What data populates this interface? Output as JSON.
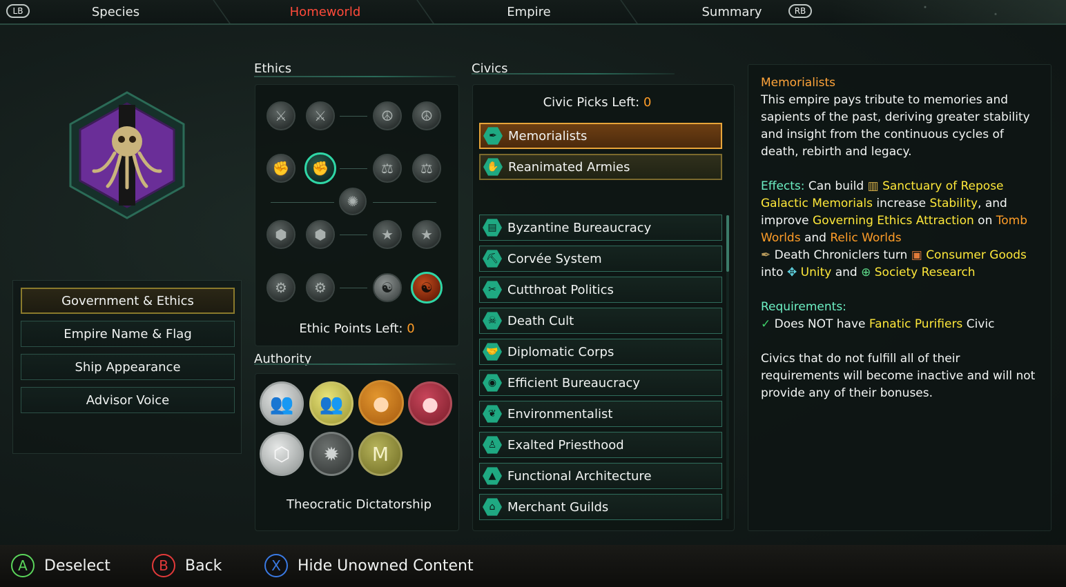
{
  "tabs": {
    "lb": "LB",
    "rb": "RB",
    "items": [
      "Species",
      "Homeworld",
      "Empire",
      "Summary"
    ],
    "active_index": 1
  },
  "left_menu": [
    "Government & Ethics",
    "Empire Name & Flag",
    "Ship Appearance",
    "Advisor Voice"
  ],
  "ethics": {
    "title": "Ethics",
    "points_label": "Ethic Points Left: ",
    "points_value": "0"
  },
  "authority": {
    "title": "Authority",
    "selected_name": "Theocratic Dictatorship"
  },
  "civics": {
    "title": "Civics",
    "picks_label": "Civic Picks Left: ",
    "picks_value": "0",
    "selected": [
      "Memorialists",
      "Reanimated Armies"
    ],
    "list": [
      "Byzantine Bureaucracy",
      "Corvée System",
      "Cutthroat Politics",
      "Death Cult",
      "Diplomatic Corps",
      "Efficient Bureaucracy",
      "Environmentalist",
      "Exalted Priesthood",
      "Functional Architecture",
      "Merchant Guilds"
    ]
  },
  "description": {
    "title": "Memorialists",
    "body": "This empire pays tribute to memories and sapients of the past, deriving greater stability and insight from the continuous cycles of death, rebirth and legacy.",
    "effects_label": "Effects:",
    "effects_t1": " Can build ",
    "sanctuary": "Sanctuary of Repose",
    "galactic": "Galactic Memorials",
    "t2": " increase ",
    "stability": "Stability",
    "t3": ", and improve ",
    "governing": "Governing Ethics Attraction",
    "t4": " on ",
    "tomb": "Tomb Worlds",
    "t5": " and ",
    "relic": "Relic Worlds",
    "t6": " Death Chroniclers turn ",
    "consumer": "Consumer Goods",
    "t7": " into ",
    "unity": "Unity",
    "t8": " and ",
    "society": "Society Research",
    "req_label": "Requirements:",
    "req_t1": " Does NOT have ",
    "req_purifiers": "Fanatic Purifiers",
    "req_t2": " Civic",
    "footer": "Civics that do not fulfill all of their requirements will become inactive and will not provide any of their bonuses."
  },
  "bottom": {
    "a_key": "A",
    "a_label": "Deselect",
    "b_key": "B",
    "b_label": "Back",
    "x_key": "X",
    "x_label": "Hide Unowned Content"
  },
  "colors": {
    "accent_teal": "#2fd6a6",
    "active_tab": "#ff4a3a",
    "highlight_orange": "#ff9d28",
    "highlight_yellow": "#ffe83a",
    "emblem_purple": "#6a2e98"
  },
  "icons": {
    "ethics": [
      "crossed-swords-icon",
      "peace-icon",
      "fist-icon",
      "scales-icon",
      "gestalt-icon",
      "collective-icon",
      "star-icon",
      "cog-icon",
      "meditation-icon"
    ],
    "authority": [
      "democratic-icon",
      "oligarchic-icon",
      "dictatorial-icon",
      "imperial-icon",
      "hive-icon",
      "machine-icon",
      "corporate-icon"
    ]
  }
}
